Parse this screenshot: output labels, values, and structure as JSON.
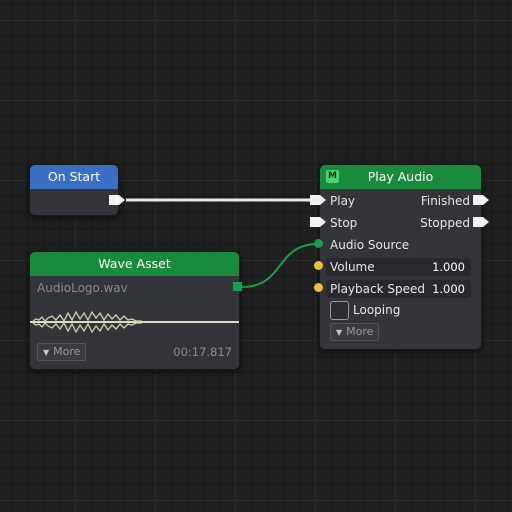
{
  "nodes": {
    "on_start": {
      "title": "On Start"
    },
    "wave_asset": {
      "title": "Wave Asset",
      "filename": "AudioLogo.wav",
      "more_label": "More",
      "duration": "00:17.817"
    },
    "play_audio": {
      "badge": "M",
      "title": "Play Audio",
      "inputs": {
        "play": "Play",
        "stop": "Stop",
        "audio_source": "Audio Source",
        "volume": "Volume",
        "playback_speed": "Playback Speed"
      },
      "outputs": {
        "finished": "Finished",
        "stopped": "Stopped"
      },
      "volume_value": "1.000",
      "playback_speed_value": "1.000",
      "looping_label": "Looping",
      "looping_checked": false,
      "more_label": "More"
    }
  },
  "colors": {
    "event_header": "#3a6fc4",
    "function_header": "#1a8a3c",
    "float_pin": "#e8c040",
    "asset_pin": "#1aa04a"
  },
  "icons": [
    "exec-pin-icon",
    "float-pin-icon",
    "asset-pin-icon",
    "dropdown-triangle-icon",
    "module-badge-icon"
  ]
}
